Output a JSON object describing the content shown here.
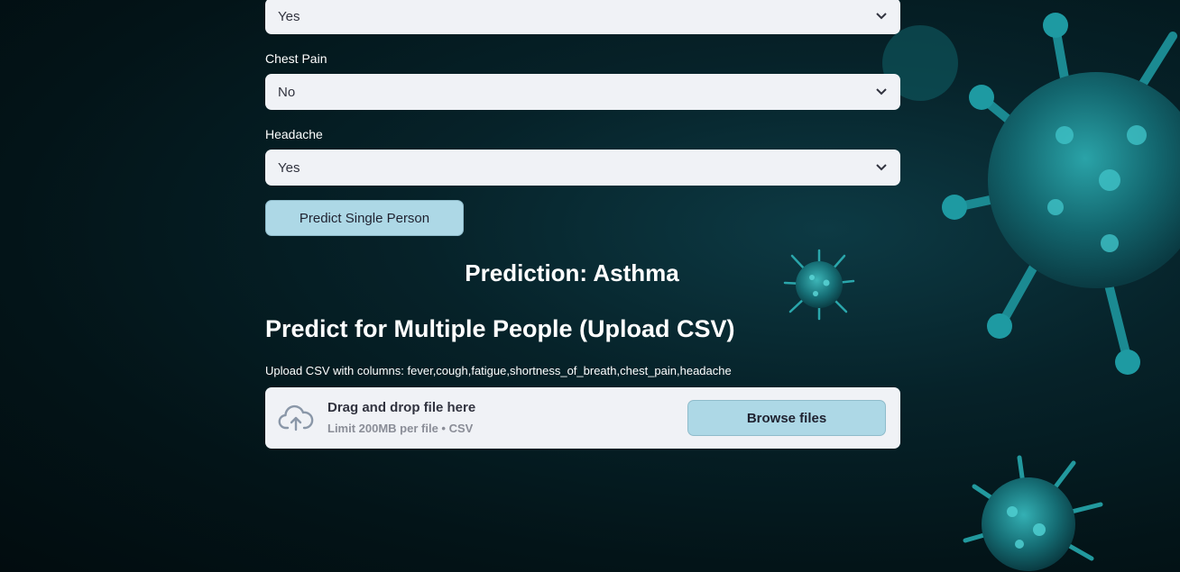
{
  "form": {
    "fields": [
      {
        "label": "",
        "value": "Yes"
      },
      {
        "label": "Chest Pain",
        "value": "No"
      },
      {
        "label": "Headache",
        "value": "Yes"
      }
    ],
    "predict_button": "Predict Single Person"
  },
  "result": {
    "prediction_text": "Prediction: Asthma"
  },
  "upload": {
    "section_title": "Predict for Multiple People (Upload CSV)",
    "caption": "Upload CSV with columns: fever,cough,fatigue,shortness_of_breath,chest_pain,headache",
    "dropzone_title": "Drag and drop file here",
    "dropzone_limit": "Limit 200MB per file • CSV",
    "browse_button": "Browse files",
    "icon": "cloud-upload-icon"
  },
  "theme": {
    "accent": "#add8e6",
    "input_bg": "#f0f2f6",
    "text_dark": "#31333f"
  }
}
